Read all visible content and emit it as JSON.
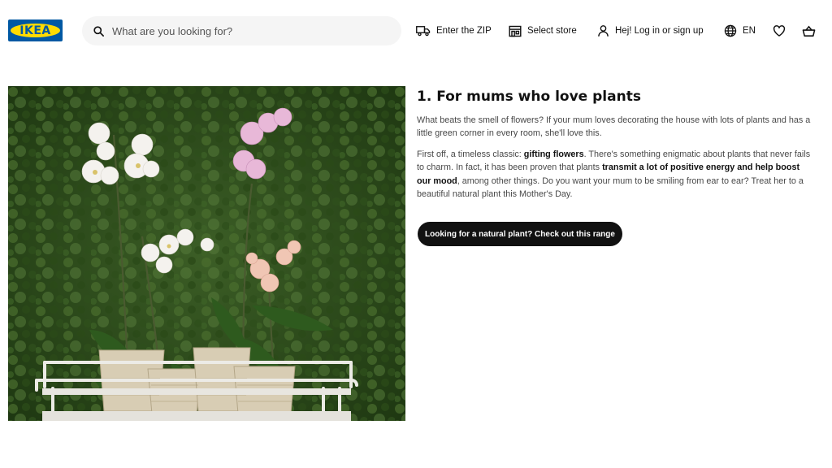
{
  "header": {
    "logo_text": "IKEA",
    "search": {
      "placeholder": "What are you looking for?",
      "value": ""
    },
    "zip_label": "Enter the ZIP",
    "store_label": "Select store",
    "login_label": "Hej! Log in or sign up",
    "language_label": "EN"
  },
  "article": {
    "title": "1. For mums who love plants",
    "paragraph1": "What beats the smell of flowers? If your mum loves decorating the house with lots of plants and has a little green corner in every room, she'll love this.",
    "paragraph2": {
      "part1": "First off, a timeless classic: ",
      "bold1": "gifting flowers",
      "part2": ". There's something enigmatic about plants that never fails to charm. In fact, it has been proven that plants ",
      "bold2": "transmit a lot of positive energy and help boost our mood",
      "part3": ", among other things. Do you want your mum to be smiling from ear to ear? Treat her to a beautiful natural plant this Mother's Day."
    },
    "cta_label": "Looking for a natural plant? Check out this range"
  },
  "icons": {
    "search": "search-icon",
    "truck": "truck-icon",
    "store": "store-icon",
    "user": "user-icon",
    "globe": "globe-icon",
    "heart": "heart-icon",
    "basket": "basket-icon"
  },
  "colors": {
    "brand_blue": "#0058a3",
    "brand_yellow": "#ffdb00",
    "cta_bg": "#111111",
    "search_bg": "#f5f5f5"
  }
}
